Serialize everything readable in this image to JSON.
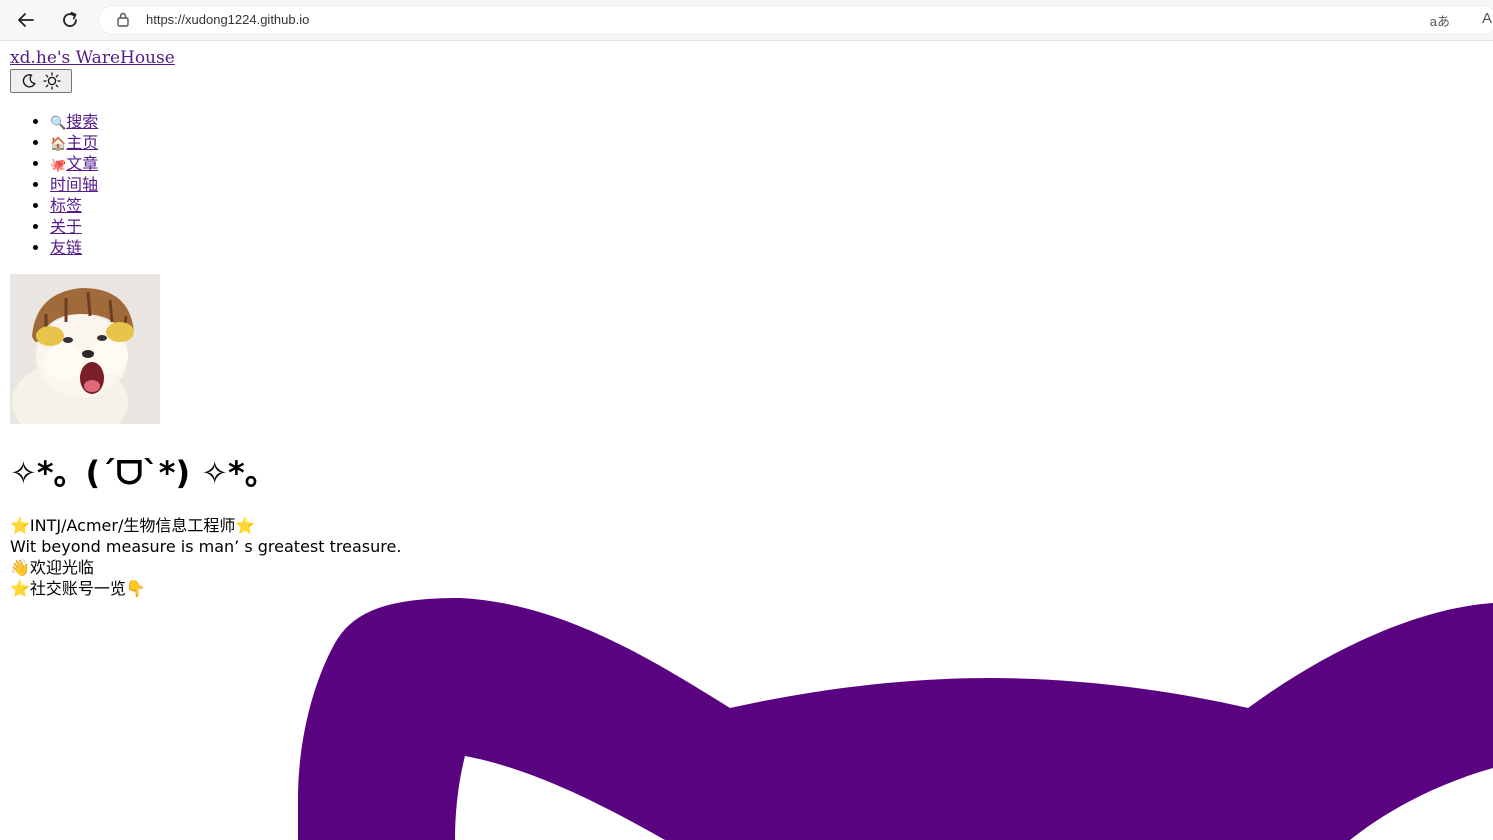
{
  "browser": {
    "url": "https://xudong1224.github.io",
    "translate_label": "aあ",
    "reader_label": "A"
  },
  "site": {
    "title": "xd.he's WareHouse"
  },
  "nav": {
    "items": [
      {
        "emoji": "🔍",
        "label": "搜索"
      },
      {
        "emoji": "🏠",
        "label": "主页"
      },
      {
        "emoji": "🐙",
        "label": "文章"
      },
      {
        "emoji": "",
        "label": "时间轴"
      },
      {
        "emoji": "",
        "label": "标签"
      },
      {
        "emoji": "",
        "label": "关于"
      },
      {
        "emoji": "",
        "label": "友链"
      }
    ]
  },
  "profile": {
    "kaomoji": "✧*。(ˊᗜˋ*) ✧*。",
    "bio_lines": [
      "⭐INTJ/Acmer/生物信息工程师⭐",
      "Wit beyond measure is man’ s greatest treasure.",
      "👋欢迎光临",
      "⭐社交账号一览👇"
    ]
  },
  "colors": {
    "octocat": "#5a0380",
    "link": "#551a8b"
  },
  "icons": {
    "back": "arrow-left-icon",
    "reload": "reload-icon",
    "lock": "lock-icon",
    "moon": "moon-icon",
    "sun": "sun-icon"
  }
}
